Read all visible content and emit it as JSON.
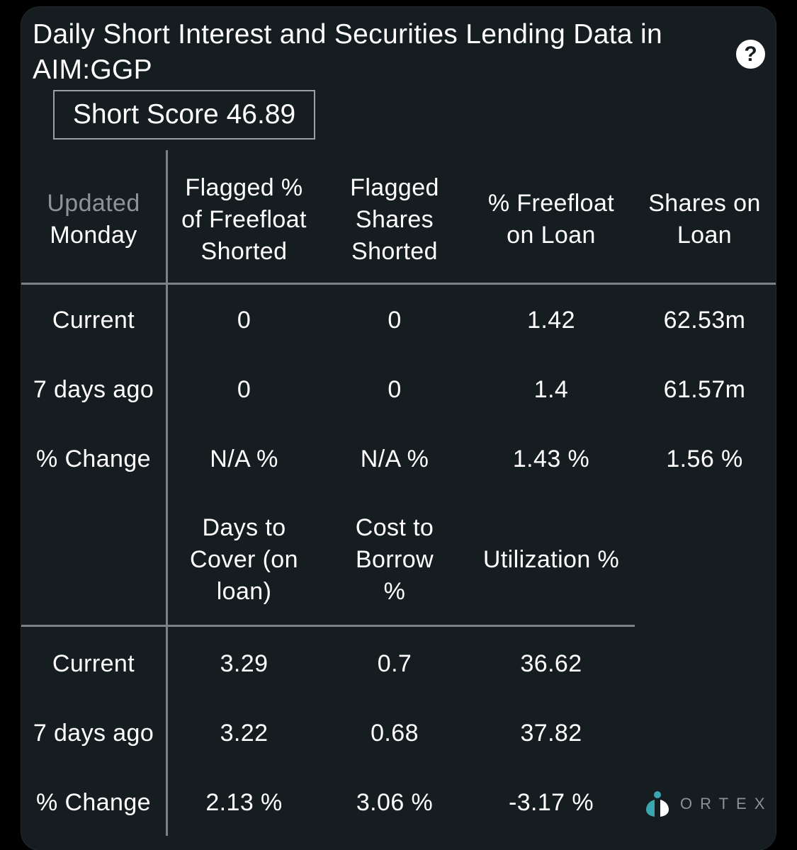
{
  "header": {
    "title": "Daily Short Interest and Securities Lending Data in AIM:GGP",
    "help_label": "?",
    "short_score": "Short Score 46.89"
  },
  "table1": {
    "corner": {
      "line1": "Updated",
      "line2": "Monday"
    },
    "columns": [
      "Flagged % of Freefloat Shorted",
      "Flagged Shares Shorted",
      "% Freefloat on Loan",
      "Shares on Loan"
    ],
    "rows": [
      {
        "label": "Current",
        "values": [
          "0",
          "0",
          "1.42",
          "62.53m"
        ]
      },
      {
        "label": "7 days ago",
        "values": [
          "0",
          "0",
          "1.4",
          "61.57m"
        ]
      },
      {
        "label": "% Change",
        "values": [
          "N/A %",
          "N/A %",
          "1.43 %",
          "1.56 %"
        ]
      }
    ]
  },
  "table2": {
    "columns": [
      "Days to Cover (on loan)",
      "Cost to Borrow %",
      "Utilization %"
    ],
    "rows": [
      {
        "label": "Current",
        "values": [
          "3.29",
          "0.7",
          "36.62"
        ]
      },
      {
        "label": "7 days ago",
        "values": [
          "3.22",
          "0.68",
          "37.82"
        ]
      },
      {
        "label": "% Change",
        "values": [
          "2.13 %",
          "3.06 %",
          "-3.17 %"
        ]
      }
    ]
  },
  "branding": {
    "logo_text": "ORTEX",
    "logo_icon": "ortex-logo-icon",
    "accent_color": "#3aa6b0"
  }
}
